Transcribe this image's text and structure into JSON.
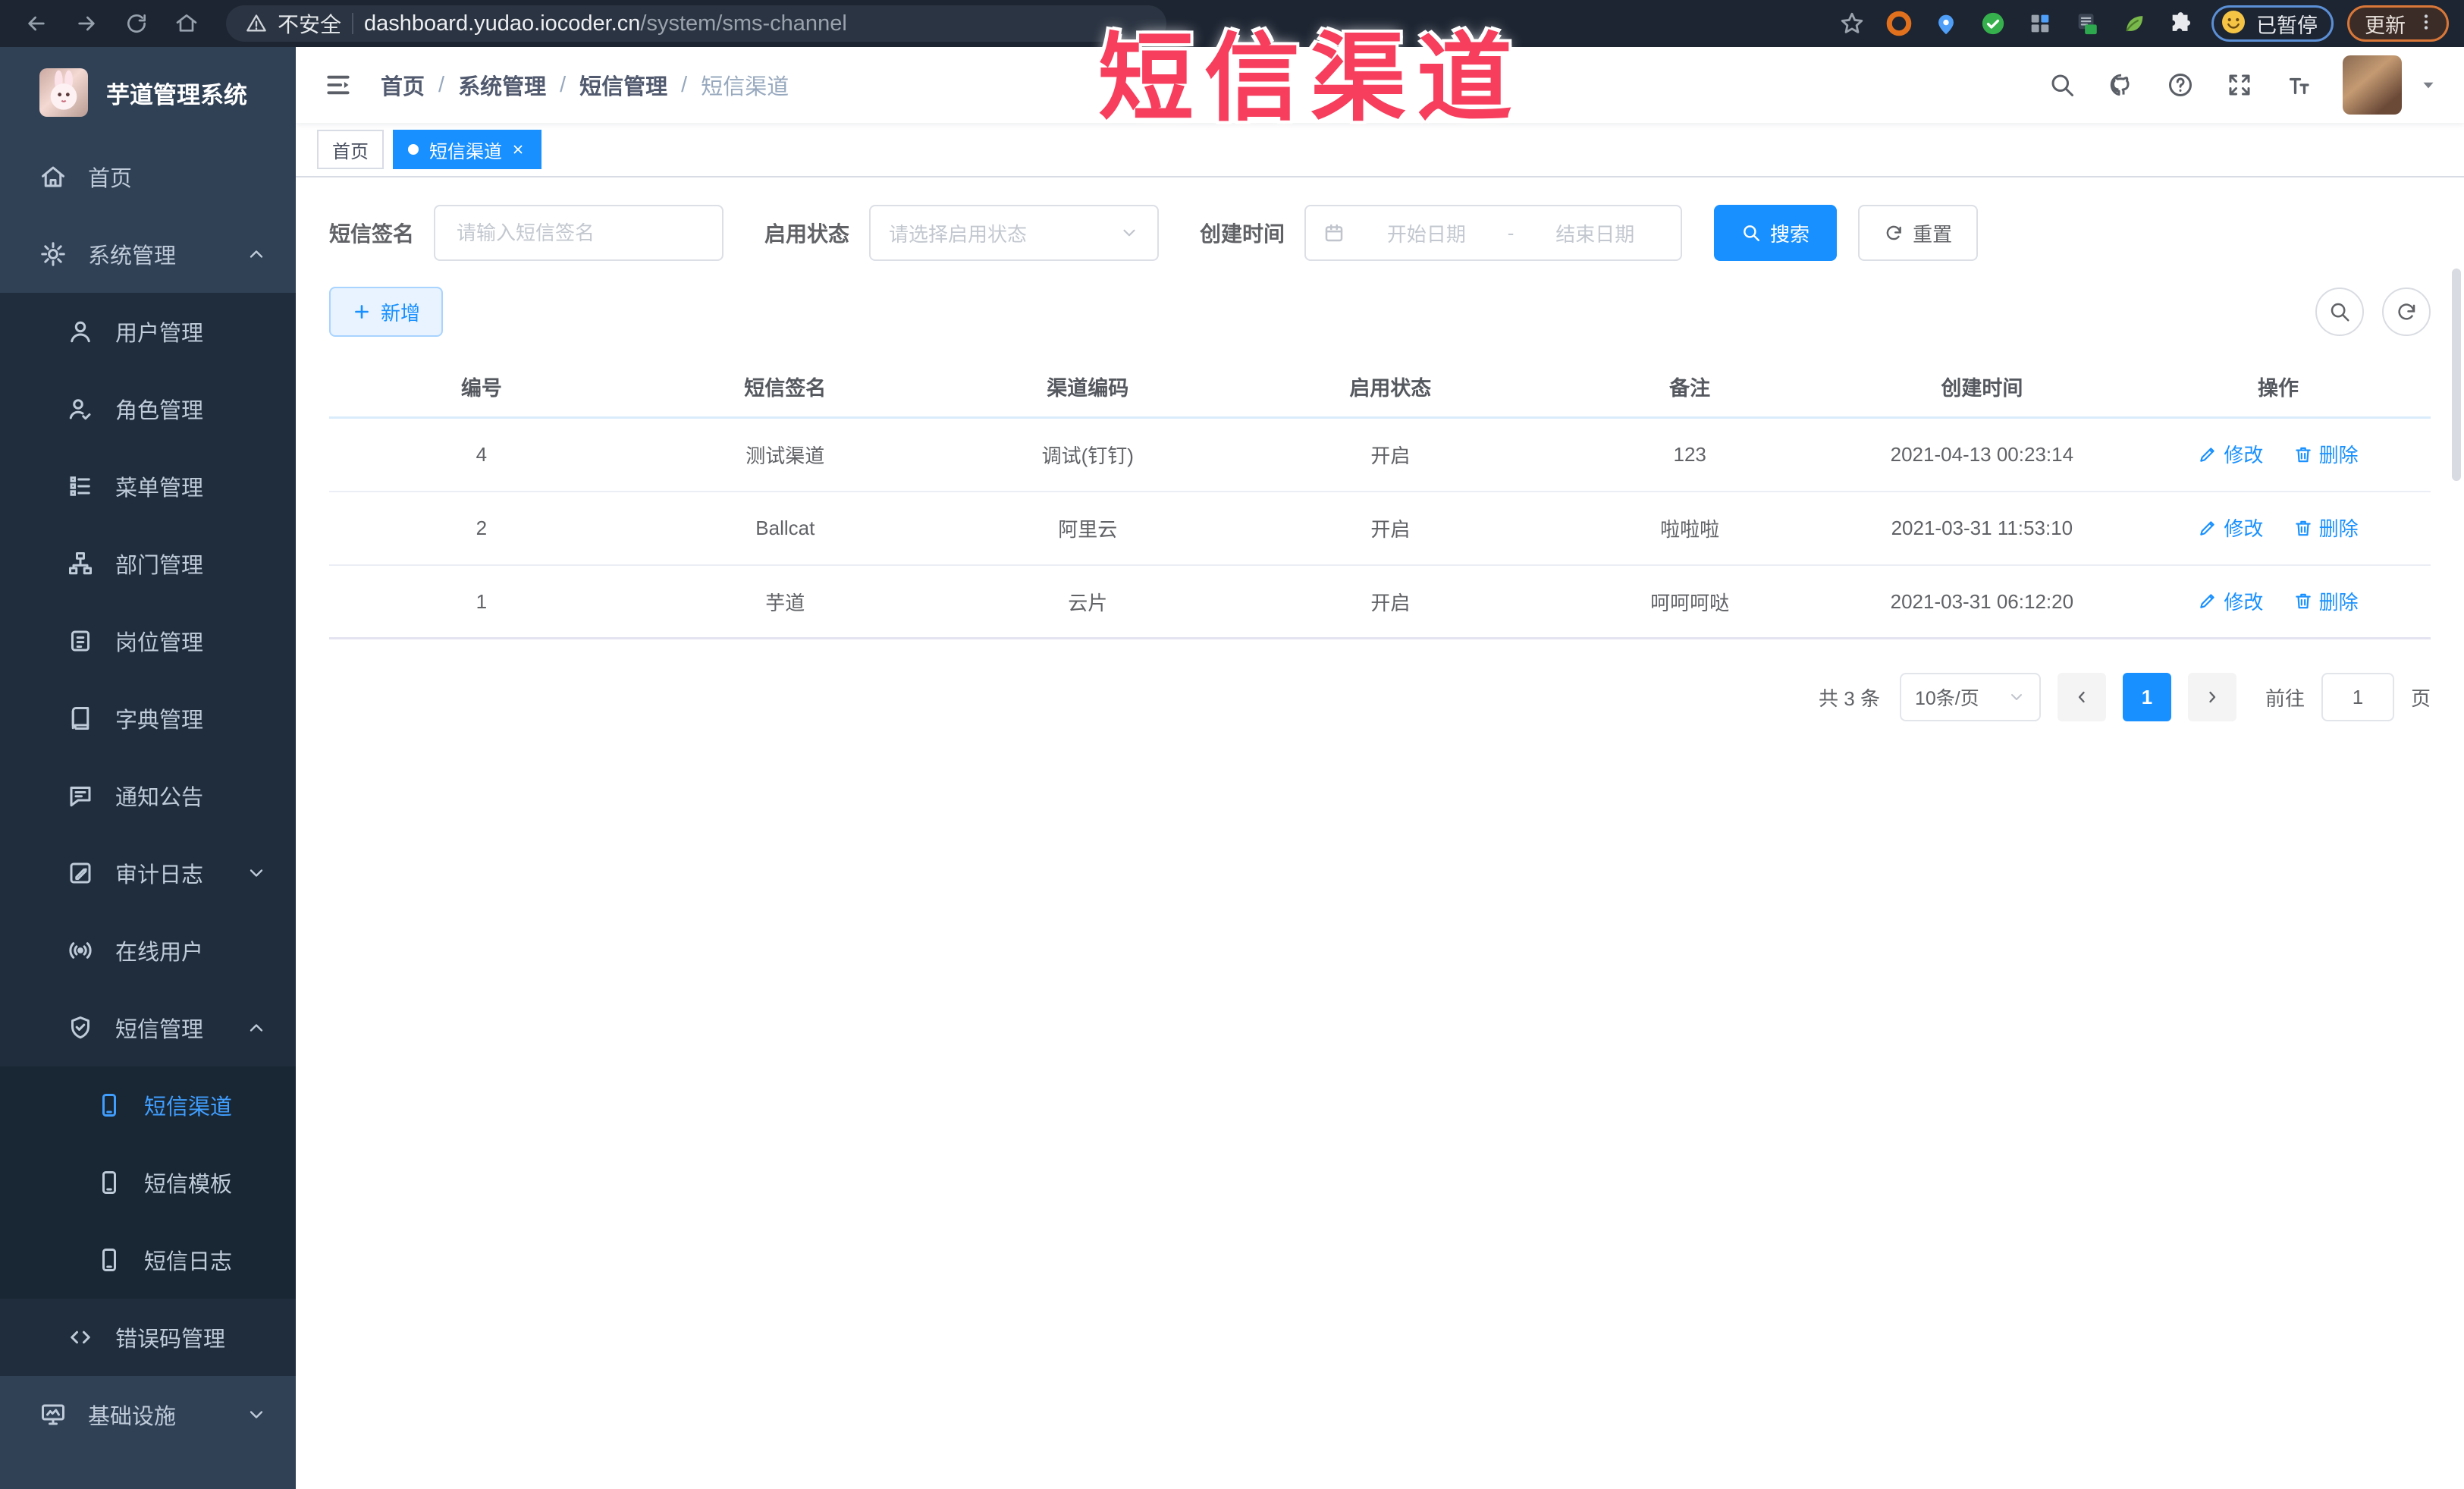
{
  "browser": {
    "security_label": "不安全",
    "url_host": "dashboard.yudao.iocoder.cn",
    "url_path": "/system/sms-channel",
    "paused_label": "已暂停",
    "update_label": "更新"
  },
  "overlay_title": "短信渠道",
  "sidebar": {
    "app_title": "芋道管理系统",
    "items": [
      {
        "label": "首页",
        "icon": "home-icon",
        "level": 1
      },
      {
        "label": "系统管理",
        "icon": "gear-icon",
        "level": 1,
        "chevron": "up"
      },
      {
        "label": "用户管理",
        "icon": "user-icon",
        "level": 2
      },
      {
        "label": "角色管理",
        "icon": "role-icon",
        "level": 2
      },
      {
        "label": "菜单管理",
        "icon": "menu-list-icon",
        "level": 2
      },
      {
        "label": "部门管理",
        "icon": "org-tree-icon",
        "level": 2
      },
      {
        "label": "岗位管理",
        "icon": "post-icon",
        "level": 2
      },
      {
        "label": "字典管理",
        "icon": "dictionary-icon",
        "level": 2
      },
      {
        "label": "通知公告",
        "icon": "notice-icon",
        "level": 2
      },
      {
        "label": "审计日志",
        "icon": "audit-log-icon",
        "level": 2,
        "chevron": "down"
      },
      {
        "label": "在线用户",
        "icon": "online-user-icon",
        "level": 2
      },
      {
        "label": "短信管理",
        "icon": "sms-shield-icon",
        "level": 2,
        "chevron": "up"
      },
      {
        "label": "短信渠道",
        "icon": "phone-icon",
        "level": 3,
        "active": true
      },
      {
        "label": "短信模板",
        "icon": "phone-icon",
        "level": 3
      },
      {
        "label": "短信日志",
        "icon": "phone-icon",
        "level": 3
      },
      {
        "label": "错误码管理",
        "icon": "code-icon",
        "level": 2
      },
      {
        "label": "基础设施",
        "icon": "infrastructure-icon",
        "level": 1,
        "chevron": "down"
      }
    ]
  },
  "breadcrumb": {
    "items": [
      "首页",
      "系统管理",
      "短信管理",
      "短信渠道"
    ],
    "separator": "/"
  },
  "tags": {
    "items": [
      {
        "label": "首页",
        "active": false
      },
      {
        "label": "短信渠道",
        "active": true,
        "closable": true
      }
    ]
  },
  "search": {
    "sign_label": "短信签名",
    "sign_placeholder": "请输入短信签名",
    "status_label": "启用状态",
    "status_placeholder": "请选择启用状态",
    "time_label": "创建时间",
    "start_placeholder": "开始日期",
    "range_separator": "-",
    "end_placeholder": "结束日期",
    "search_label": "搜索",
    "reset_label": "重置"
  },
  "toolbar": {
    "add_label": "新增"
  },
  "table": {
    "headers": [
      "编号",
      "短信签名",
      "渠道编码",
      "启用状态",
      "备注",
      "创建时间",
      "操作"
    ],
    "edit_label": "修改",
    "delete_label": "删除",
    "rows": [
      {
        "id": "4",
        "sign": "测试渠道",
        "code": "调试(钉钉)",
        "status": "开启",
        "remark": "123",
        "created": "2021-04-13 00:23:14"
      },
      {
        "id": "2",
        "sign": "Ballcat",
        "code": "阿里云",
        "status": "开启",
        "remark": "啦啦啦",
        "created": "2021-03-31 11:53:10"
      },
      {
        "id": "1",
        "sign": "芋道",
        "code": "云片",
        "status": "开启",
        "remark": "呵呵呵哒",
        "created": "2021-03-31 06:12:20"
      }
    ]
  },
  "pagination": {
    "total_label": "共 3 条",
    "page_size": "10条/页",
    "current_page": "1",
    "goto_label": "前往",
    "goto_value": "1",
    "page_unit": "页"
  },
  "colors": {
    "accent": "#1890ff",
    "menu_active": "#409eff",
    "sidebar_bg": "#304156",
    "submenu_bg": "#1f2d3d",
    "overlay_red": "#f73e5d",
    "browser_bar_bg": "#1d2532"
  }
}
